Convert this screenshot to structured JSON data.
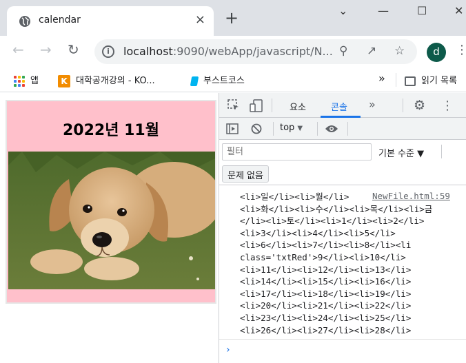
{
  "browser": {
    "tab_title": "calendar",
    "tab_close": "×",
    "new_tab": "+",
    "url_host": "localhost",
    "url_path": ":9090/webApp/javascript/N...",
    "avatar_letter": "d",
    "window_controls": {
      "minimize": "—",
      "maximize": "☐",
      "close": "✕",
      "tab_search": "⌄"
    }
  },
  "bookmarks": {
    "items": [
      {
        "label": "앱",
        "icon": "apps-grid-icon"
      },
      {
        "label": "대학공개강의 - KO...",
        "icon": "kocw-logo"
      },
      {
        "label": "부스트코스",
        "icon": "boostcourse-logo"
      }
    ],
    "overflow": "»",
    "reading_list": "읽기 목록"
  },
  "page": {
    "calendar_title": "2022년 11월",
    "image_alt": "golden retriever puppy lying on grass"
  },
  "devtools": {
    "tabs": [
      {
        "label": "요소"
      },
      {
        "label": "콘솔",
        "active": true
      }
    ],
    "more_tabs": "»",
    "context": "top",
    "filter_placeholder": "필터",
    "level": "기본 수준",
    "issues": "문제 없음",
    "log_source": "NewFile.html:59",
    "log_lines": [
      "<li>일</li><li>월</li>",
      "<li>화</li><li>수</li><li>목</li><li>금",
      "</li><li>토</li><li>1</li><li>2</li>",
      "<li>3</li><li>4</li><li>5</li>",
      "<li>6</li><li>7</li><li>8</li><li",
      "class='txtRed'>9</li><li>10</li>",
      "<li>11</li><li>12</li><li>13</li>",
      "<li>14</li><li>15</li><li>16</li>",
      "<li>17</li><li>18</li><li>19</li>",
      "<li>20</li><li>21</li><li>22</li>",
      "<li>23</li><li>24</li><li>25</li>",
      "<li>26</li><li>27</li><li>28</li>"
    ],
    "prompt": "›"
  }
}
